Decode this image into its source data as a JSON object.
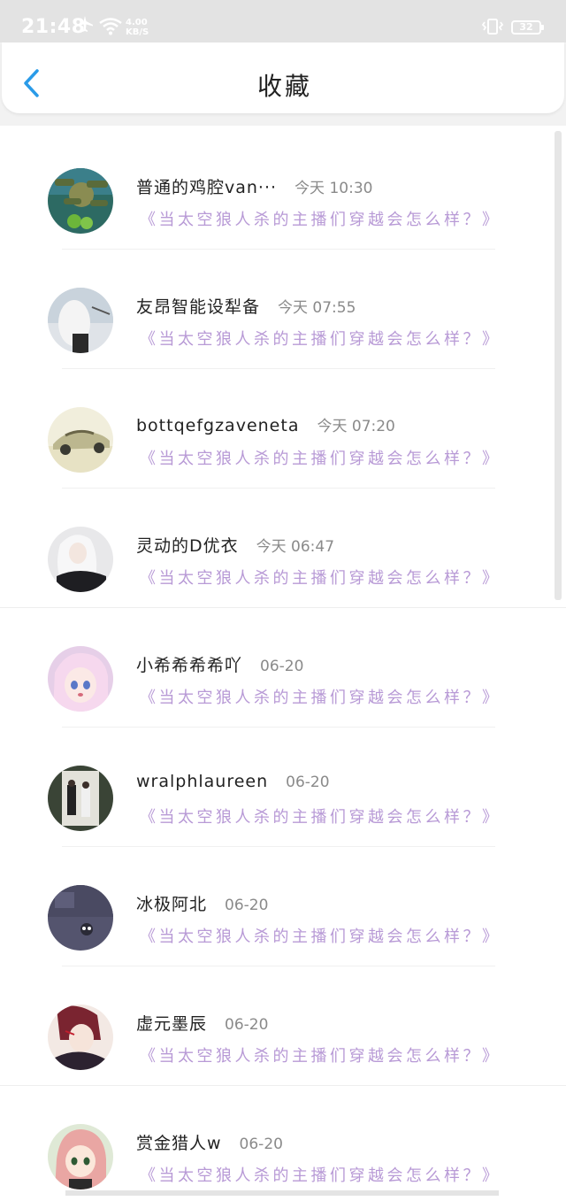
{
  "status_bar": {
    "time": "21:48",
    "speed_value": "4.00",
    "speed_unit": "KB/S",
    "battery": "32"
  },
  "header": {
    "title": "收藏"
  },
  "favorites": [
    {
      "name": "普通的鸡腔van···",
      "time": "今天 10:30",
      "title": "《当太空狼人杀的主播们穿越会怎么样？》",
      "avatar": "plants-zombies"
    },
    {
      "name": "友昂智能设犁备",
      "time": "今天 07:55",
      "title": "《当太空狼人杀的主播们穿越会怎么样？》",
      "avatar": "person-white"
    },
    {
      "name": "bottqefgzaveneta",
      "time": "今天 07:20",
      "title": "《当太空狼人杀的主播们穿越会怎么样？》",
      "avatar": "sports-car"
    },
    {
      "name": "灵动的D优衣",
      "time": "今天 06:47",
      "title": "《当太空狼人杀的主播们穿越会怎么样？》",
      "avatar": "anime-girl-white-hair"
    },
    {
      "name": "小希希希希吖",
      "time": "06-20",
      "title": "《当太空狼人杀的主播们穿越会怎么样？》",
      "avatar": "anime-girl-pink"
    },
    {
      "name": "wralphlaureen",
      "time": "06-20",
      "title": "《当太空狼人杀的主播们穿越会怎么样？》",
      "avatar": "couple-photo"
    },
    {
      "name": "冰极阿北",
      "time": "06-20",
      "title": "《当太空狼人杀的主播们穿越会怎么样？》",
      "avatar": "dark-room"
    },
    {
      "name": "虚元墨辰",
      "time": "06-20",
      "title": "《当太空狼人杀的主播们穿越会怎么样？》",
      "avatar": "anime-boy-red"
    },
    {
      "name": "赏金猎人w",
      "time": "06-20",
      "title": "《当太空狼人杀的主播们穿越会怎么样？》",
      "avatar": "anime-girl-pink-hair"
    }
  ],
  "colors": {
    "title_purple": "#b89ad6",
    "back_blue": "#2a9be8",
    "status_bar": "#e3e3e3"
  }
}
